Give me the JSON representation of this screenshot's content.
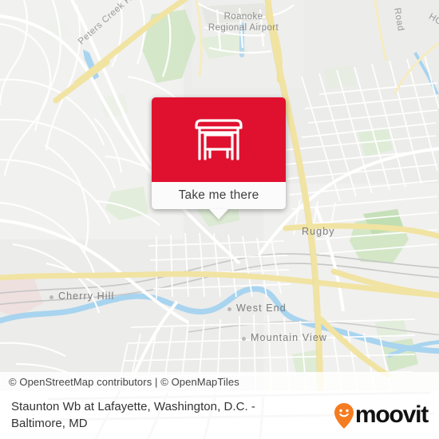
{
  "map": {
    "name": "roanoke-virginia-map",
    "labels": {
      "airport": "Roanoke\nRegional Airport",
      "airport_line1": "Roanoke",
      "airport_line2": "Regional Airport",
      "peters_creek": "Peters Creek Road Northwest",
      "rugby": "Rugby",
      "cherry_hill": "Cherry Hill",
      "west_end": "West End",
      "mountain_view": "Mountain View",
      "road_right": "Road",
      "road_right2": "HO"
    },
    "colors": {
      "background": "#e9e9e6",
      "land": "#efefed",
      "park": "#cfe5c2",
      "water": "#a8d4ef",
      "road_major": "#f6e9a8",
      "road_minor": "#ffffff",
      "rail": "#c3c3c3"
    }
  },
  "callout": {
    "icon": "bus-shelter-icon",
    "button_label": "Take me there",
    "accent_color": "#e0112f",
    "background_color": "#fbfbfb"
  },
  "attribution": {
    "text": "© OpenStreetMap contributors | © OpenMapTiles"
  },
  "footer": {
    "title": "Staunton Wb at Lafayette, Washington, D.C. - Baltimore, MD",
    "brand_name": "moovit",
    "brand_pin_color": "#f57c20"
  }
}
